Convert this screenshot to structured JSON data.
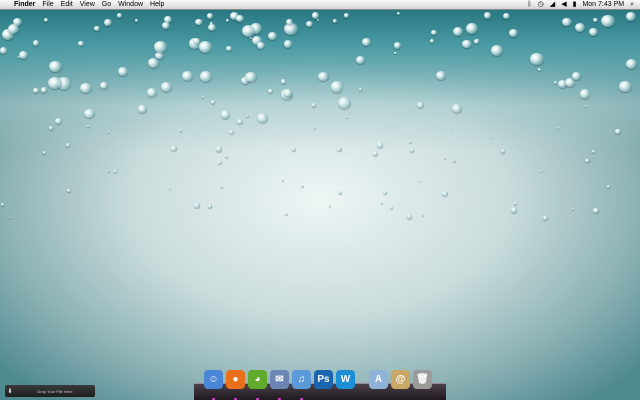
{
  "menubar": {
    "apple": "",
    "app": "Finder",
    "items": [
      "File",
      "Edit",
      "View",
      "Go",
      "Window",
      "Help"
    ],
    "status_icons": [
      "bluetooth-icon",
      "time-machine-icon",
      "wifi-icon",
      "volume-icon",
      "battery-icon"
    ],
    "clock": "Mon 7:43 PM",
    "spotlight": "⌕"
  },
  "dock": {
    "items": [
      {
        "name": "Finder",
        "icon": "finder-icon",
        "glyph": "☺",
        "color": "#4a86d8",
        "running": true
      },
      {
        "name": "Firefox",
        "icon": "firefox-icon",
        "glyph": "●",
        "color": "#e8701a",
        "running": true
      },
      {
        "name": "Adium",
        "icon": "adium-icon",
        "glyph": "◕",
        "color": "#5faa2a",
        "running": true
      },
      {
        "name": "Mail",
        "icon": "mail-icon",
        "glyph": "✉",
        "color": "#6b86b5",
        "running": true
      },
      {
        "name": "iTunes",
        "icon": "itunes-icon",
        "glyph": "♫",
        "color": "#5a9ad8",
        "running": true
      },
      {
        "name": "Photoshop",
        "icon": "photoshop-icon",
        "glyph": "Ps",
        "color": "#1a64b0",
        "running": false
      },
      {
        "name": "Word",
        "icon": "word-icon",
        "glyph": "W",
        "color": "#1b8ed6",
        "running": false
      }
    ],
    "stacks": [
      {
        "name": "Applications",
        "icon": "applications-folder-icon",
        "glyph": "A",
        "color": "#8fb3d8"
      },
      {
        "name": "Address Book",
        "icon": "address-book-icon",
        "glyph": "@",
        "color": "#c9a867"
      },
      {
        "name": "Trash",
        "icon": "trash-icon",
        "glyph": "🗑",
        "color": "#9a9a9a"
      }
    ]
  },
  "dropbox_widget": {
    "arrow": "⬇",
    "label": "Drop Your File Here"
  }
}
